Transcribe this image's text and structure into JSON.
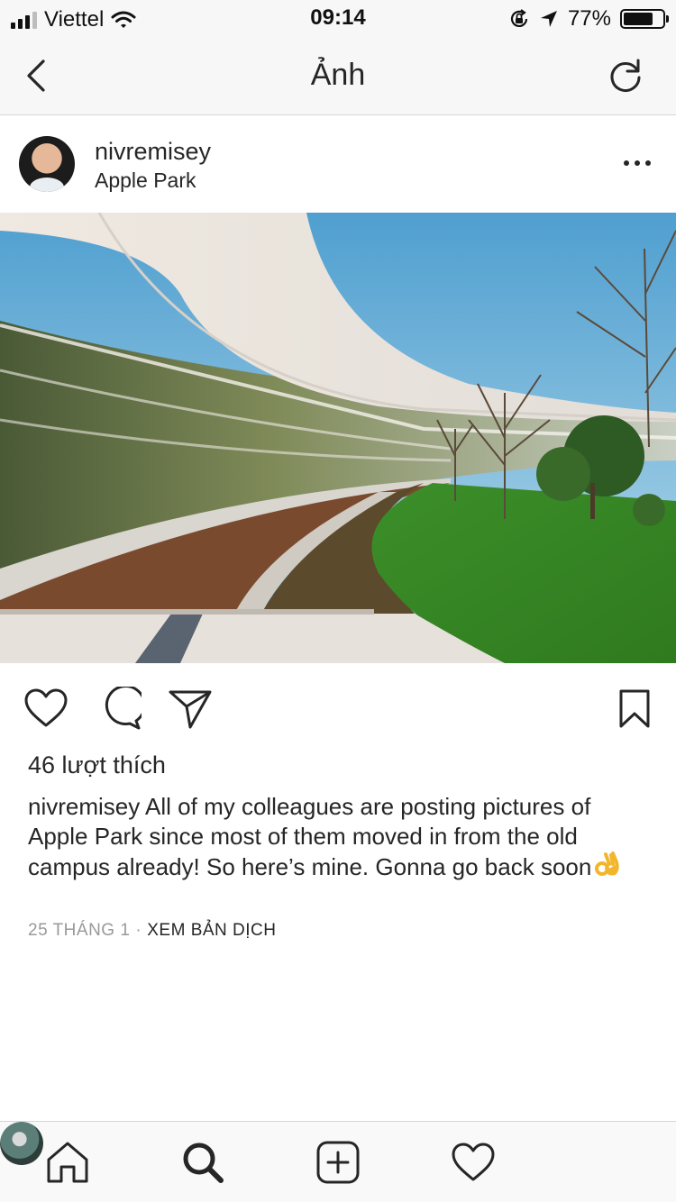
{
  "status_bar": {
    "carrier": "Viettel",
    "time": "09:14",
    "battery_percent": "77%",
    "battery_level": 0.77,
    "icons": [
      "signal-bars-icon",
      "wifi-icon",
      "rotation-lock-icon",
      "location-arrow-icon",
      "battery-icon"
    ]
  },
  "nav": {
    "title": "Ảnh",
    "back_icon": "chevron-left-icon",
    "refresh_icon": "refresh-icon"
  },
  "post": {
    "username": "nivremisey",
    "location": "Apple Park",
    "more_icon": "ellipsis-icon",
    "photo_description_icon": "photo",
    "likes": "46 lượt thích",
    "caption_user": "nivremisey",
    "caption_text": " All of my colleagues are posting pictures of Apple Park since most of them moved in from the old campus already! So here’s mine. Gonna go back soon",
    "date": "25 THÁNG 1",
    "separator": "·",
    "translate_label": "XEM BẢN DỊCH"
  },
  "tab_bar": {
    "items": [
      "home-icon",
      "search-icon",
      "add-post-icon",
      "activity-heart-icon",
      "profile-avatar"
    ]
  },
  "colors": {
    "text": "#262626",
    "muted": "#999999",
    "bar_bg": "#f7f7f7",
    "divider": "#d6d6d6"
  }
}
